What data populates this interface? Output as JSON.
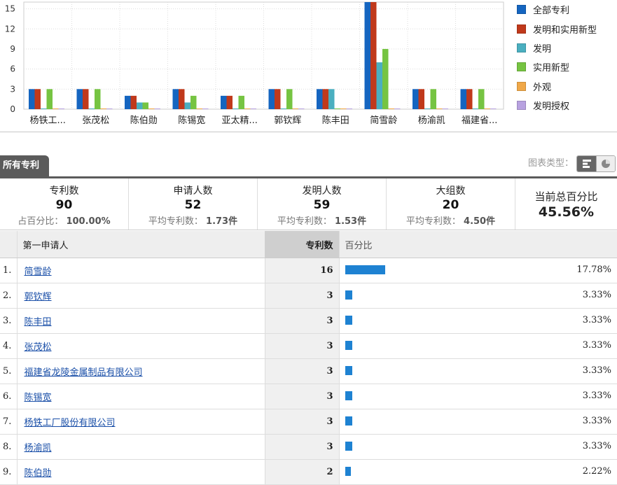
{
  "chart_data": {
    "type": "bar",
    "categories": [
      "杨铁工...",
      "张茂松",
      "陈伯勋",
      "陈锡宽",
      "亚太精...",
      "郭钦辉",
      "陈丰田",
      "简雪龄",
      "杨渝凯",
      "福建省..."
    ],
    "series": [
      {
        "name": "全部专利",
        "color": "#1565c0",
        "values": [
          3,
          3,
          2,
          3,
          2,
          3,
          3,
          16,
          3,
          3
        ]
      },
      {
        "name": "发明和实用新型",
        "color": "#c0391b",
        "values": [
          3,
          3,
          2,
          3,
          2,
          3,
          3,
          16,
          3,
          3
        ]
      },
      {
        "name": "发明",
        "color": "#4aafc0",
        "values": [
          0,
          0,
          1,
          1,
          0,
          0,
          3,
          7,
          0,
          0
        ]
      },
      {
        "name": "实用新型",
        "color": "#76c442",
        "values": [
          3,
          3,
          1,
          2,
          2,
          3,
          0,
          9,
          3,
          3
        ]
      },
      {
        "name": "外观",
        "color": "#f0a848",
        "values": [
          0,
          0,
          0,
          0,
          0,
          0,
          0,
          0,
          0,
          0
        ]
      },
      {
        "name": "发明授权",
        "color": "#b8a2e0",
        "values": [
          0,
          0,
          0,
          0,
          0,
          0,
          0,
          0,
          0,
          0
        ]
      }
    ],
    "yticks": [
      0,
      3,
      6,
      9,
      12,
      15
    ],
    "ylim": [
      0,
      16
    ],
    "grid": true,
    "legend": "right"
  },
  "tabs": {
    "all_patents": "所有专利"
  },
  "chart_type": {
    "label": "图表类型："
  },
  "stats": [
    {
      "title": "专利数",
      "value": "90",
      "sub_label": "占百分比：",
      "sub_value": "100.00%"
    },
    {
      "title": "申请人数",
      "value": "52",
      "sub_label": "平均专利数：",
      "sub_value": "1.73件"
    },
    {
      "title": "发明人数",
      "value": "59",
      "sub_label": "平均专利数：",
      "sub_value": "1.53件"
    },
    {
      "title": "大组数",
      "value": "20",
      "sub_label": "平均专利数：",
      "sub_value": "4.50件"
    }
  ],
  "total": {
    "title": "当前总百分比",
    "value": "45.56%"
  },
  "table": {
    "headers": {
      "name": "第一申请人",
      "count": "专利数",
      "pct": "百分比"
    },
    "rows": [
      {
        "idx": "1.",
        "name": "简雪龄",
        "count": "16",
        "pct": "17.78%",
        "ratio": 0.1778
      },
      {
        "idx": "2.",
        "name": "郭钦辉",
        "count": "3",
        "pct": "3.33%",
        "ratio": 0.0333
      },
      {
        "idx": "3.",
        "name": "陈丰田",
        "count": "3",
        "pct": "3.33%",
        "ratio": 0.0333
      },
      {
        "idx": "4.",
        "name": "张茂松",
        "count": "3",
        "pct": "3.33%",
        "ratio": 0.0333
      },
      {
        "idx": "5.",
        "name": "福建省龙陵金属制品有限公司",
        "count": "3",
        "pct": "3.33%",
        "ratio": 0.0333
      },
      {
        "idx": "6.",
        "name": "陈锡宽",
        "count": "3",
        "pct": "3.33%",
        "ratio": 0.0333
      },
      {
        "idx": "7.",
        "name": "杨铁工厂股份有限公司",
        "count": "3",
        "pct": "3.33%",
        "ratio": 0.0333
      },
      {
        "idx": "8.",
        "name": "杨渝凯",
        "count": "3",
        "pct": "3.33%",
        "ratio": 0.0333
      },
      {
        "idx": "9.",
        "name": "陈伯勋",
        "count": "2",
        "pct": "2.22%",
        "ratio": 0.0222
      }
    ]
  }
}
